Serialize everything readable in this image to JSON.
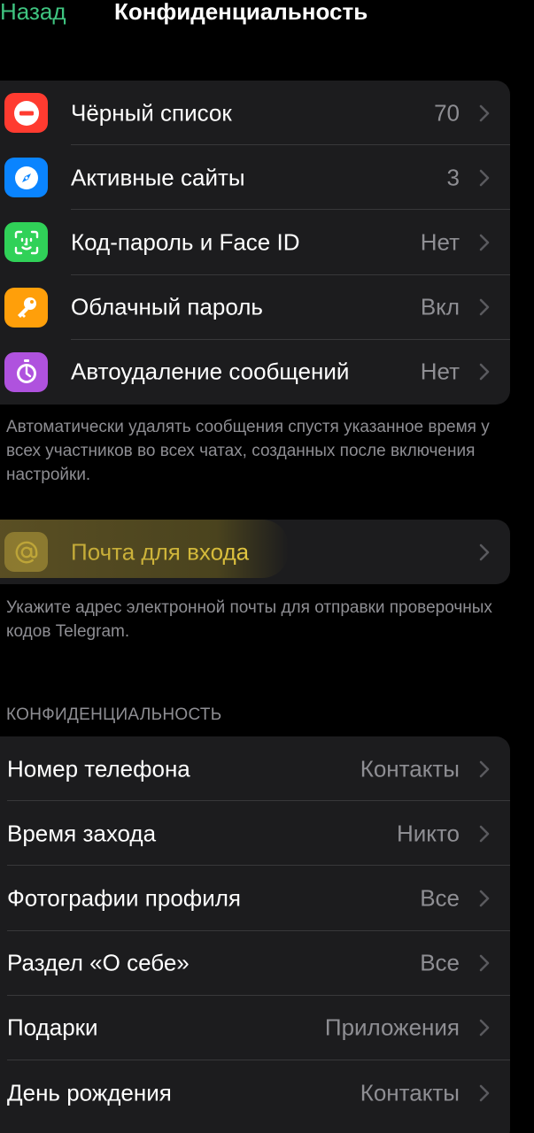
{
  "nav": {
    "back_label": "Назад",
    "title": "Конфиденциальность"
  },
  "security_group": {
    "items": [
      {
        "label": "Чёрный список",
        "value": "70",
        "icon": "block-icon",
        "color": "#ff3b30"
      },
      {
        "label": "Активные сайты",
        "value": "3",
        "icon": "compass-icon",
        "color": "#0a84ff"
      },
      {
        "label": "Код-пароль и Face ID",
        "value": "Нет",
        "icon": "face-id-icon",
        "color": "#30d158"
      },
      {
        "label": "Облачный пароль",
        "value": "Вкл",
        "icon": "key-icon",
        "color": "#ff9f0a"
      },
      {
        "label": "Автоудаление сообщений",
        "value": "Нет",
        "icon": "timer-icon",
        "color": "#af52de"
      }
    ],
    "footer": "Автоматически удалять сообщения спустя указанное время у всех участников во всех чатах, созданных после включения настройки."
  },
  "email_group": {
    "label": "Почта для входа",
    "icon": "at-icon",
    "highlight_color": "#f2d44a",
    "footer": "Укажите адрес электронной почты для отправки проверочных кодов Telegram."
  },
  "privacy_section": {
    "header": "КОНФИДЕНЦИАЛЬНОСТЬ",
    "items": [
      {
        "label": "Номер телефона",
        "value": "Контакты"
      },
      {
        "label": "Время захода",
        "value": "Никто"
      },
      {
        "label": "Фотографии профиля",
        "value": "Все"
      },
      {
        "label": "Раздел «О себе»",
        "value": "Все"
      },
      {
        "label": "Подарки",
        "value": "Приложения"
      },
      {
        "label": "День рождения",
        "value": "Контакты"
      }
    ]
  }
}
